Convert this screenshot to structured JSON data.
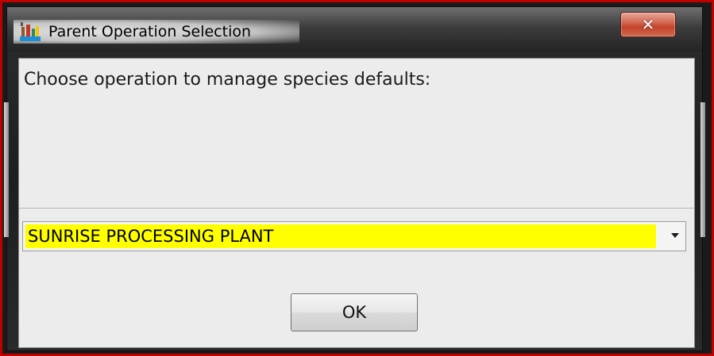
{
  "window": {
    "title": "Parent Operation Selection",
    "close_icon": "✕",
    "icons": {
      "app": "app-icon",
      "close": "close-icon",
      "dropdown": "chevron-down-icon"
    }
  },
  "dialog": {
    "prompt": "Choose operation to manage species defaults:",
    "operation_select": {
      "selected": "SUNRISE PROCESSING PLANT"
    },
    "ok_label": "OK"
  },
  "colors": {
    "frame_highlight": "#c00000",
    "selection_highlight": "#ffff00",
    "close_button": "#c2432a"
  }
}
